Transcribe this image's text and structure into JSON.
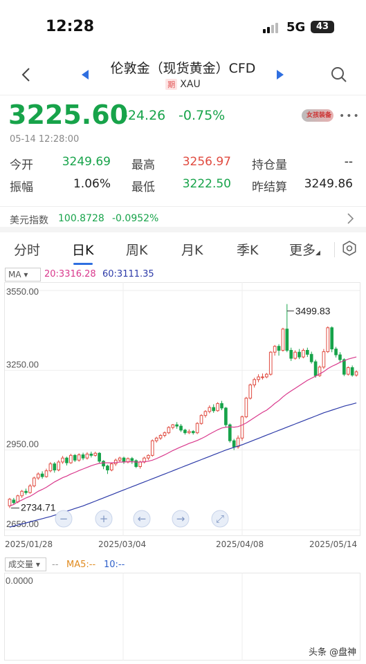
{
  "status": {
    "time": "12:28",
    "network": "5G",
    "battery": "43"
  },
  "nav": {
    "title": "伦敦金（现货黄金）CFD",
    "tag": "期",
    "symbol": "XAU"
  },
  "quote": {
    "price": "3225.60",
    "change": "-24.26",
    "change_pct": "-0.75%",
    "datetime": "05-14 12:28:00",
    "avatar_text": "女孩装备",
    "stats": [
      [
        {
          "label": "今开",
          "value": "3249.69",
          "color": "#17a34a"
        },
        {
          "label": "最高",
          "value": "3256.97",
          "color": "#e04a3f"
        },
        {
          "label": "持仓量",
          "value": "--",
          "color": "#222"
        }
      ],
      [
        {
          "label": "振幅",
          "value": "1.06%",
          "color": "#222"
        },
        {
          "label": "最低",
          "value": "3222.50",
          "color": "#17a34a"
        },
        {
          "label": "昨结算",
          "value": "3249.86",
          "color": "#222"
        }
      ]
    ]
  },
  "usd_index": {
    "label": "美元指数",
    "value": "100.8728",
    "change": "-0.0952%"
  },
  "tabs": [
    {
      "label": "分时",
      "active": false
    },
    {
      "label": "日K",
      "active": true
    },
    {
      "label": "周K",
      "active": false
    },
    {
      "label": "月K",
      "active": false
    },
    {
      "label": "季K",
      "active": false
    },
    {
      "label": "更多",
      "active": false
    }
  ],
  "ma": {
    "select": "MA",
    "ma20": "20:3316.28",
    "ma60": "60:3111.35"
  },
  "chart_data": {
    "type": "candlestick",
    "y_ticks": [
      "3550.00",
      "3250.00",
      "2950.00",
      "2650.00"
    ],
    "ylim": [
      2650,
      3550
    ],
    "x_ticks": [
      "2025/01/28",
      "2025/03/04",
      "2025/04/08",
      "2025/05/14"
    ],
    "high_label": "3499.83",
    "low_label": "2734.71",
    "grid": true,
    "candles": [
      [
        2740,
        2765,
        2732,
        2770
      ],
      [
        2762,
        2752,
        2745,
        2770
      ],
      [
        2755,
        2778,
        2750,
        2782
      ],
      [
        2778,
        2795,
        2770,
        2800
      ],
      [
        2795,
        2790,
        2782,
        2805
      ],
      [
        2790,
        2815,
        2786,
        2822
      ],
      [
        2815,
        2845,
        2810,
        2850
      ],
      [
        2845,
        2860,
        2838,
        2866
      ],
      [
        2860,
        2850,
        2842,
        2870
      ],
      [
        2850,
        2872,
        2846,
        2880
      ],
      [
        2872,
        2898,
        2866,
        2905
      ],
      [
        2898,
        2875,
        2865,
        2905
      ],
      [
        2875,
        2905,
        2870,
        2912
      ],
      [
        2905,
        2920,
        2898,
        2928
      ],
      [
        2920,
        2902,
        2892,
        2925
      ],
      [
        2902,
        2930,
        2898,
        2936
      ],
      [
        2930,
        2912,
        2905,
        2935
      ],
      [
        2912,
        2932,
        2906,
        2938
      ],
      [
        2932,
        2920,
        2912,
        2940
      ],
      [
        2920,
        2935,
        2914,
        2942
      ],
      [
        2935,
        2930,
        2922,
        2944
      ],
      [
        2930,
        2938,
        2925,
        2944
      ],
      [
        2938,
        2908,
        2900,
        2942
      ],
      [
        2908,
        2890,
        2878,
        2912
      ],
      [
        2890,
        2875,
        2860,
        2895
      ],
      [
        2875,
        2898,
        2870,
        2902
      ],
      [
        2898,
        2912,
        2890,
        2918
      ],
      [
        2912,
        2920,
        2905,
        2925
      ],
      [
        2920,
        2905,
        2898,
        2925
      ],
      [
        2905,
        2918,
        2900,
        2922
      ],
      [
        2918,
        2910,
        2898,
        2924
      ],
      [
        2910,
        2888,
        2882,
        2915
      ],
      [
        2888,
        2905,
        2880,
        2910
      ],
      [
        2905,
        2920,
        2900,
        2925
      ],
      [
        2920,
        2930,
        2912,
        2934
      ],
      [
        2930,
        2985,
        2925,
        2990
      ],
      [
        2985,
        2995,
        2978,
        3000
      ],
      [
        2995,
        3005,
        2988,
        3010
      ],
      [
        3005,
        3015,
        2998,
        3020
      ],
      [
        3015,
        3035,
        3010,
        3040
      ],
      [
        3035,
        3045,
        3028,
        3048
      ],
      [
        3045,
        3040,
        3030,
        3055
      ],
      [
        3040,
        3025,
        3018,
        3048
      ],
      [
        3025,
        3015,
        3008,
        3030
      ],
      [
        3015,
        3020,
        3010,
        3028
      ],
      [
        3020,
        3015,
        3008,
        3025
      ],
      [
        3015,
        3050,
        3010,
        3055
      ],
      [
        3050,
        3080,
        3045,
        3085
      ],
      [
        3080,
        3095,
        3072,
        3100
      ],
      [
        3095,
        3110,
        3088,
        3118
      ],
      [
        3110,
        3098,
        3090,
        3122
      ],
      [
        3098,
        3125,
        3094,
        3130
      ],
      [
        3125,
        3108,
        3100,
        3135
      ],
      [
        3108,
        3045,
        3035,
        3112
      ],
      [
        3045,
        2985,
        2978,
        3050
      ],
      [
        2985,
        2962,
        2950,
        2992
      ],
      [
        2962,
        2995,
        2955,
        3005
      ],
      [
        2995,
        3075,
        2985,
        3080
      ],
      [
        3075,
        3145,
        3070,
        3150
      ],
      [
        3145,
        3195,
        3140,
        3200
      ],
      [
        3195,
        3215,
        3185,
        3222
      ],
      [
        3215,
        3225,
        3205,
        3235
      ],
      [
        3225,
        3225,
        3215,
        3238
      ],
      [
        3225,
        3235,
        3220,
        3240
      ],
      [
        3235,
        3318,
        3230,
        3322
      ],
      [
        3318,
        3340,
        3305,
        3345
      ],
      [
        3340,
        3325,
        3305,
        3348
      ],
      [
        3325,
        3405,
        3320,
        3410
      ],
      [
        3405,
        3325,
        3318,
        3499
      ],
      [
        3325,
        3295,
        3285,
        3335
      ],
      [
        3295,
        3318,
        3290,
        3325
      ],
      [
        3318,
        3300,
        3292,
        3330
      ],
      [
        3300,
        3325,
        3295,
        3332
      ],
      [
        3325,
        3310,
        3300,
        3335
      ],
      [
        3310,
        3282,
        3275,
        3320
      ],
      [
        3282,
        3230,
        3222,
        3290
      ],
      [
        3230,
        3262,
        3225,
        3268
      ],
      [
        3262,
        3320,
        3255,
        3330
      ],
      [
        3320,
        3410,
        3315,
        3415
      ],
      [
        3410,
        3330,
        3318,
        3415
      ],
      [
        3330,
        3308,
        3298,
        3338
      ],
      [
        3308,
        3290,
        3278,
        3318
      ],
      [
        3290,
        3235,
        3228,
        3295
      ],
      [
        3235,
        3260,
        3230,
        3265
      ],
      [
        3260,
        3232,
        3226,
        3268
      ],
      [
        3232,
        3244,
        3226,
        3250
      ]
    ],
    "ma20": [
      2740,
      2745,
      2755,
      2762,
      2770,
      2776,
      2785,
      2795,
      2802,
      2810,
      2820,
      2830,
      2838,
      2846,
      2852,
      2860,
      2866,
      2873,
      2879,
      2885,
      2891,
      2896,
      2900,
      2902,
      2902,
      2902,
      2903,
      2905,
      2905,
      2906,
      2906,
      2905,
      2905,
      2906,
      2908,
      2912,
      2918,
      2925,
      2932,
      2940,
      2948,
      2955,
      2962,
      2968,
      2975,
      2980,
      2986,
      2993,
      3001,
      3010,
      3018,
      3026,
      3033,
      3036,
      3037,
      3036,
      3038,
      3044,
      3052,
      3062,
      3072,
      3082,
      3092,
      3100,
      3112,
      3125,
      3136,
      3150,
      3162,
      3172,
      3182,
      3192,
      3202,
      3212,
      3220,
      3228,
      3236,
      3245,
      3256,
      3265,
      3272,
      3280,
      3286,
      3292,
      3296,
      3300
    ],
    "ma60": [
      2660,
      2664,
      2668,
      2672,
      2676,
      2680,
      2684,
      2688,
      2692,
      2696,
      2700,
      2705,
      2710,
      2715,
      2720,
      2725,
      2730,
      2735,
      2740,
      2746,
      2752,
      2758,
      2764,
      2770,
      2776,
      2782,
      2788,
      2794,
      2800,
      2806,
      2812,
      2818,
      2824,
      2830,
      2836,
      2842,
      2848,
      2854,
      2860,
      2866,
      2872,
      2878,
      2884,
      2890,
      2896,
      2902,
      2908,
      2914,
      2920,
      2926,
      2932,
      2938,
      2944,
      2950,
      2955,
      2960,
      2965,
      2970,
      2976,
      2982,
      2988,
      2994,
      3000,
      3006,
      3012,
      3018,
      3024,
      3030,
      3036,
      3042,
      3048,
      3054,
      3060,
      3066,
      3072,
      3078,
      3084,
      3090,
      3095,
      3100,
      3105,
      3110,
      3115,
      3119,
      3123,
      3127
    ],
    "controls": [
      "zoom-out",
      "zoom-in",
      "scroll-left",
      "scroll-right",
      "reset"
    ]
  },
  "volume": {
    "select": "成交量",
    "dash": "--",
    "ma5": "MA5:--",
    "ma10": "10:--",
    "y_tick": "0.0000"
  },
  "watermark": "头条 @盘神",
  "colors": {
    "up": "#e04a3f",
    "down": "#17a34a",
    "ma20": "#d9388c",
    "ma60": "#2c3aa8",
    "accent": "#2f6fe0"
  }
}
